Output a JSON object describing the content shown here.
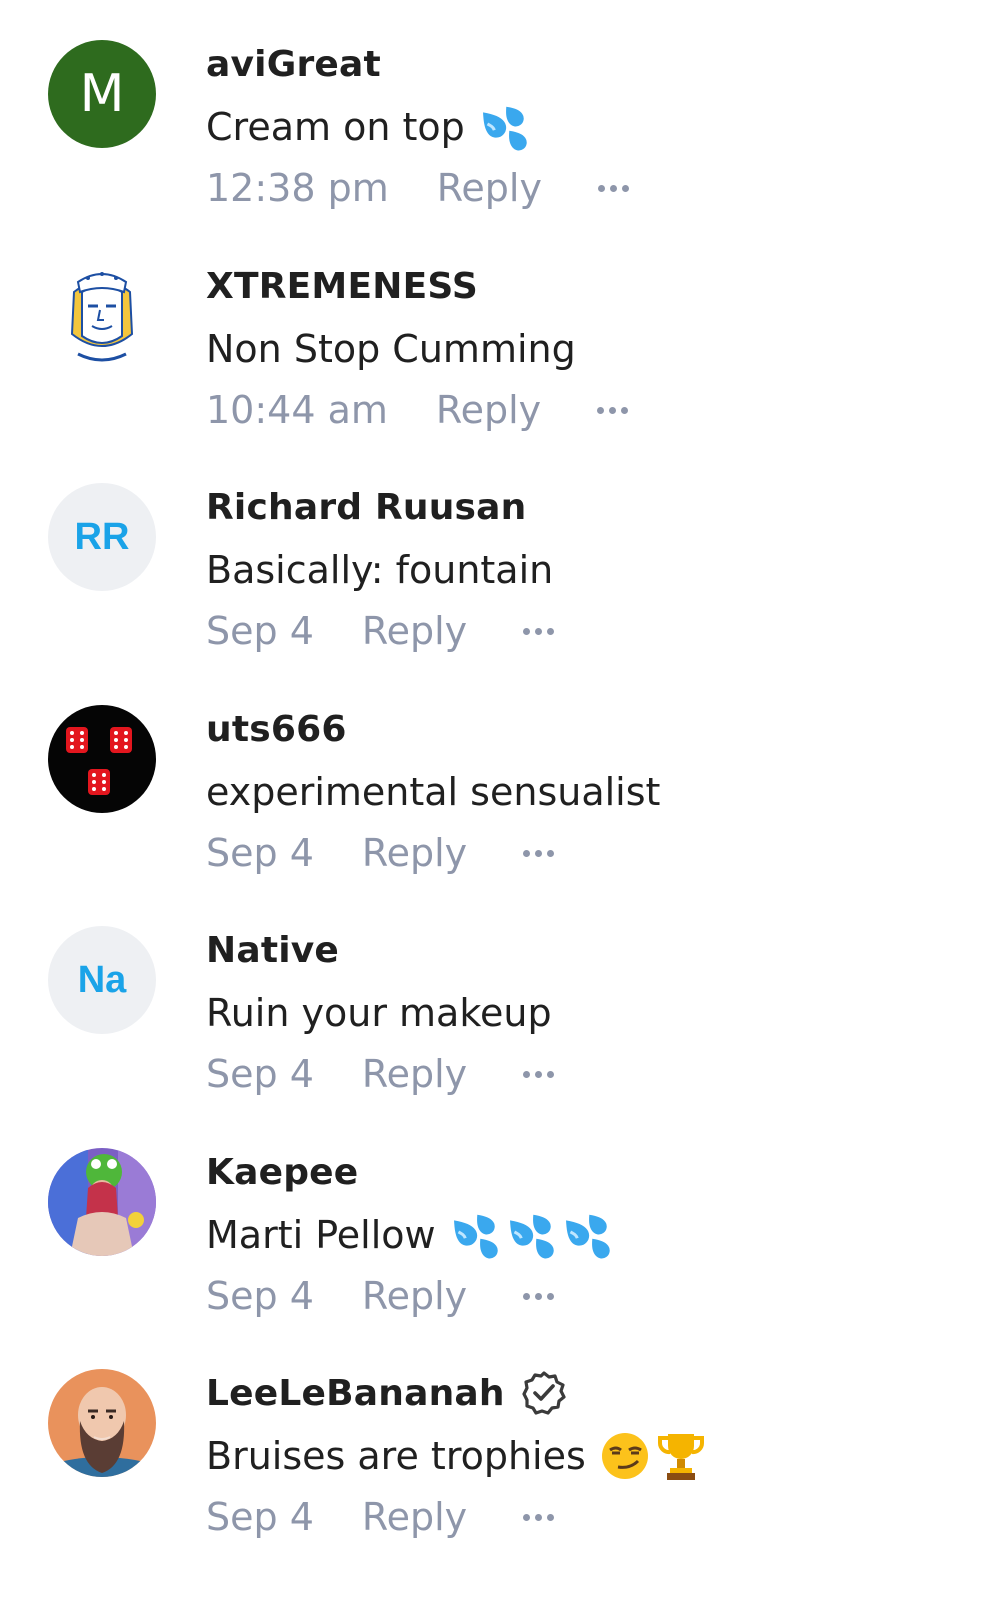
{
  "colors": {
    "username": "#202020",
    "meta": "#8e96aa",
    "initials": "#1aa3e8",
    "initials_bg": "#eef0f3",
    "green_avatar": "#2e6b1e"
  },
  "comments": [
    {
      "username": "aviGreat",
      "avatar": {
        "type": "letter",
        "text": "M",
        "bg": "#2e6b1e"
      },
      "text": "Cream on top",
      "emojis": [
        "sweat-droplets-emoji"
      ],
      "time": "12:38 pm",
      "reply_label": "Reply"
    },
    {
      "username": "XTREMENESS",
      "avatar": {
        "type": "illustration",
        "icon": "sketch-face-avatar"
      },
      "text": "Non Stop Cumming",
      "emojis": [],
      "time": "10:44 am",
      "reply_label": "Reply"
    },
    {
      "username": "Richard Ruusan",
      "avatar": {
        "type": "initials",
        "text": "RR"
      },
      "text": "Basically: fountain",
      "emojis": [],
      "time": "Sep 4",
      "reply_label": "Reply"
    },
    {
      "username": "uts666",
      "avatar": {
        "type": "illustration",
        "icon": "red-dice-avatar"
      },
      "text": "experimental sensualist",
      "emojis": [],
      "time": "Sep 4",
      "reply_label": "Reply"
    },
    {
      "username": "Native",
      "avatar": {
        "type": "initials",
        "text": "Na"
      },
      "text": "Ruin your makeup",
      "emojis": [],
      "time": "Sep 4",
      "reply_label": "Reply"
    },
    {
      "username": "Kaepee",
      "avatar": {
        "type": "photo",
        "icon": "photo-avatar"
      },
      "text": "Marti Pellow",
      "emojis": [
        "sweat-droplets-emoji",
        "sweat-droplets-emoji",
        "sweat-droplets-emoji"
      ],
      "time": "Sep 4",
      "reply_label": "Reply"
    },
    {
      "username": "LeeLeBananah",
      "verified": true,
      "avatar": {
        "type": "illustration",
        "icon": "bearded-man-avatar"
      },
      "text": "Bruises are trophies",
      "emojis": [
        "smirking-face-emoji",
        "trophy-emoji"
      ],
      "time": "Sep 4",
      "reply_label": "Reply"
    }
  ]
}
